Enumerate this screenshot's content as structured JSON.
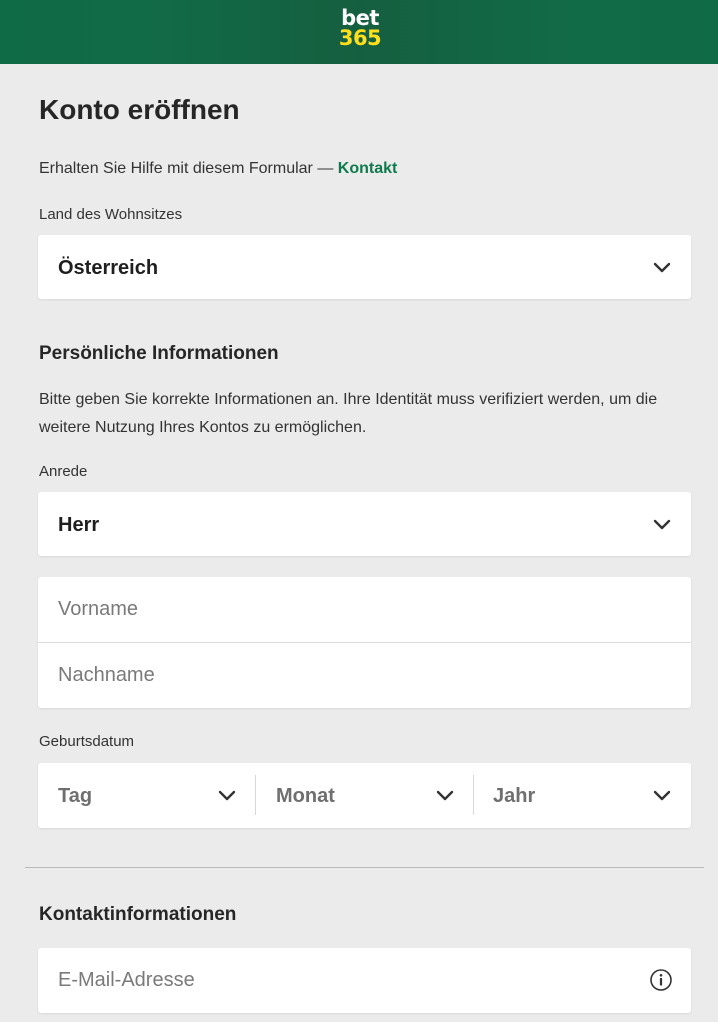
{
  "brand": {
    "logo_top": "bet",
    "logo_bottom": "365"
  },
  "page": {
    "title": "Konto eröffnen",
    "help_text": "Erhalten Sie Hilfe mit diesem Formular — ",
    "help_link": "Kontakt"
  },
  "residence": {
    "label": "Land des Wohnsitzes",
    "value": "Österreich",
    "icon": "chevron-down-icon"
  },
  "personal": {
    "title": "Persönliche Informationen",
    "description": "Bitte geben Sie korrekte Informationen an. Ihre Identität muss verifiziert werden, um die weitere Nutzung Ihres Kontos zu ermöglichen.",
    "salutation_label": "Anrede",
    "salutation_value": "Herr",
    "firstname_placeholder": "Vorname",
    "lastname_placeholder": "Nachname",
    "dob_label": "Geburtsdatum",
    "dob_day": "Tag",
    "dob_month": "Monat",
    "dob_year": "Jahr"
  },
  "contact": {
    "title": "Kontaktinformationen",
    "email_placeholder": "E-Mail-Adresse",
    "icon": "info-icon"
  },
  "colors": {
    "header_green": "#126b47",
    "accent_green": "#0f7a4e",
    "logo_yellow": "#ffdf1b",
    "background": "#ebebeb"
  }
}
